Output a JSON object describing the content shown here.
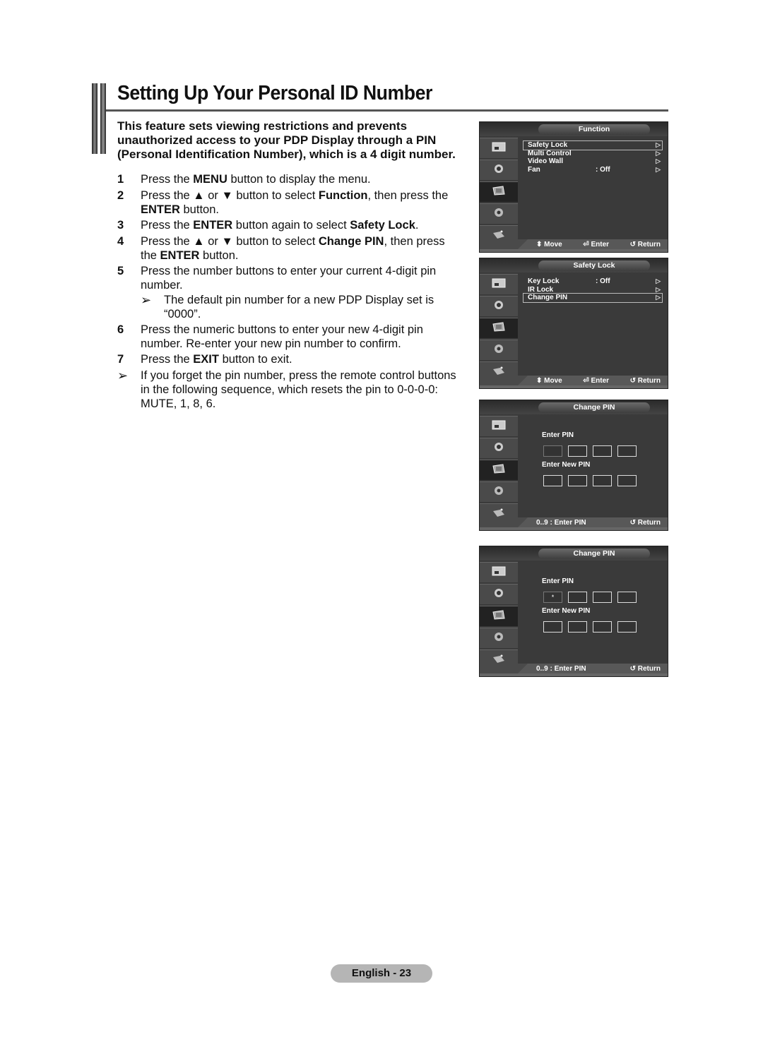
{
  "page": {
    "title": "Setting Up Your Personal ID Number",
    "intro": "This feature sets viewing restrictions and prevents unauthorized access to your PDP Display through a PIN (Personal Identification Number), which is a 4 digit number.",
    "steps": [
      {
        "num": "1",
        "parts": [
          "Press the ",
          "MENU",
          " button to display the menu."
        ]
      },
      {
        "num": "2",
        "parts": [
          "Press the ▲ or ▼ button to select ",
          "Function",
          ", then press the ",
          "ENTER",
          " button."
        ]
      },
      {
        "num": "3",
        "parts": [
          "Press the ",
          "ENTER",
          " button again to select ",
          "Safety Lock",
          "."
        ]
      },
      {
        "num": "4",
        "parts": [
          "Press the ▲ or ▼ button to select ",
          "Change PIN",
          ", then press the ",
          "ENTER",
          " button."
        ]
      },
      {
        "num": "5",
        "parts": [
          "Press the number buttons to enter your current 4-digit pin number."
        ]
      },
      {
        "num": "6",
        "parts": [
          "Press the numeric buttons to enter your new 4-digit pin number. Re-enter your new pin number to confirm."
        ]
      },
      {
        "num": "7",
        "parts": [
          "Press the ",
          "EXIT",
          " button to exit."
        ]
      }
    ],
    "note_step5": "The default pin number for a new PDP Display set is “0000”.",
    "tip": "If you forget the pin number, press the remote control buttons in the following sequence, which resets the pin to 0-0-0-0: MUTE, 1, 8, 6.",
    "arrow_glyph": "➢",
    "footer": "English - 23"
  },
  "osd": {
    "hint_move": "Move",
    "hint_enter": "Enter",
    "hint_return": "Return",
    "hint_pin": "0..9 : Enter PIN",
    "screens": [
      {
        "header": "Function",
        "items": [
          {
            "label": "Safety Lock",
            "value": "",
            "selected": true
          },
          {
            "label": "Multi Control",
            "value": ""
          },
          {
            "label": "Video Wall",
            "value": ""
          },
          {
            "label": "Fan",
            "value": ": Off"
          }
        ]
      },
      {
        "header": "Safety Lock",
        "items": [
          {
            "label": "Key Lock",
            "value": ": Off"
          },
          {
            "label": "IR Lock",
            "value": ""
          },
          {
            "label": "Change PIN",
            "value": "",
            "selected": true
          }
        ]
      },
      {
        "header": "Change PIN",
        "enter_pin_label": "Enter PIN",
        "new_pin_label": "Enter New PIN",
        "entered": [
          "",
          "",
          "",
          ""
        ]
      },
      {
        "header": "Change PIN",
        "enter_pin_label": "Enter PIN",
        "new_pin_label": "Enter New PIN",
        "entered": [
          "*",
          "",
          "",
          ""
        ]
      }
    ]
  }
}
